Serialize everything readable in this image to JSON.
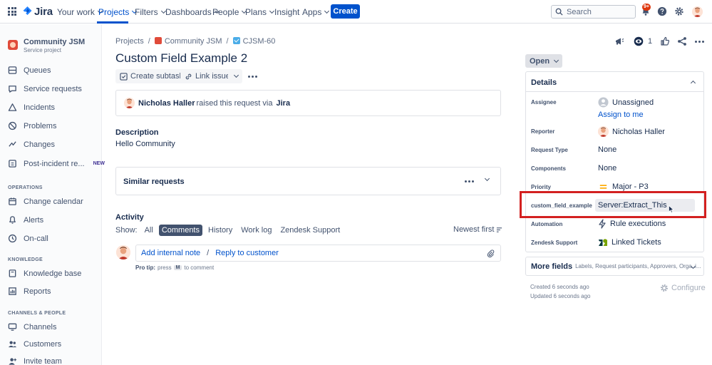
{
  "app": {
    "logo_text": "Jira"
  },
  "topnav": {
    "items": [
      "Your work",
      "Projects",
      "Filters",
      "Dashboards",
      "People",
      "Plans",
      "Insight",
      "Apps"
    ],
    "create_label": "Create",
    "search_placeholder": "Search",
    "notifications_badge": "9+"
  },
  "sidebar": {
    "project_name": "Community JSM",
    "project_type": "Service project",
    "items": [
      "Queues",
      "Service requests",
      "Incidents",
      "Problems",
      "Changes",
      "Post-incident re..."
    ],
    "new_label": "NEW",
    "operations_heading": "OPERATIONS",
    "operations_items": [
      "Change calendar",
      "Alerts",
      "On-call"
    ],
    "knowledge_heading": "KNOWLEDGE",
    "knowledge_items": [
      "Knowledge base",
      "Reports"
    ],
    "channels_heading": "CHANNELS & PEOPLE",
    "channels_items": [
      "Channels",
      "Customers",
      "Invite team"
    ]
  },
  "breadcrumb": {
    "root": "Projects",
    "project": "Community JSM",
    "issue_key": "CJSM-60"
  },
  "issue": {
    "title": "Custom Field Example 2",
    "create_subtask_label": "Create subtask",
    "link_issue_label": "Link issue",
    "raised_by": "Nicholas Haller",
    "raised_text": "raised this request via",
    "raised_via": "Jira",
    "description_label": "Description",
    "description": "Hello Community",
    "similar_label": "Similar requests"
  },
  "activity": {
    "label": "Activity",
    "show_label": "Show:",
    "tabs": [
      "All",
      "Comments",
      "History",
      "Work log",
      "Zendesk Support"
    ],
    "active_tab": "Comments",
    "sort_label": "Newest first",
    "add_internal_note": "Add internal note",
    "comment_sep": "/",
    "reply_to_customer": "Reply to customer",
    "protip_label": "Pro tip:",
    "protip_press": "press",
    "protip_key": "M",
    "protip_rest": "to comment"
  },
  "right_panel": {
    "watch_count": "1",
    "status": "Open",
    "details_label": "Details",
    "fields": {
      "assignee_label": "Assignee",
      "assignee": "Unassigned",
      "assign_to_me": "Assign to me",
      "reporter_label": "Reporter",
      "reporter": "Nicholas Haller",
      "request_type_label": "Request Type",
      "request_type": "None",
      "components_label": "Components",
      "components": "None",
      "priority_label": "Priority",
      "priority": "Major - P3",
      "custom_label": "custom_field_example",
      "custom_value": "Server:Extract_This",
      "automation_label": "Automation",
      "automation": "Rule executions",
      "zendesk_label": "Zendesk Support",
      "zendesk": "Linked Tickets"
    },
    "more_fields_label": "More fields",
    "more_fields_list": "Labels, Request participants, Approvers, Organi...",
    "created": "Created 6 seconds ago",
    "updated": "Updated 6 seconds ago",
    "configure_label": "Configure"
  },
  "colors": {
    "brand": "#0052cc",
    "highlight": "#d32020",
    "badge": "#de350b"
  }
}
